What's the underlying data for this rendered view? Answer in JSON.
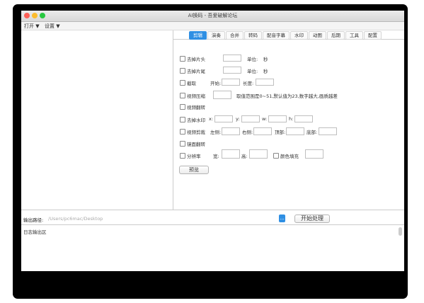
{
  "window": {
    "title": "AI换码 - 吾爱破解论坛",
    "colors": {
      "close": "#fc5f57",
      "minimize": "#fdbc2e",
      "zoom": "#28c840",
      "accent": "#2f8fe3"
    }
  },
  "menubar": {
    "open": "打开 ▼",
    "settings": "设置 ▼"
  },
  "tabs": [
    "剪辑",
    "演奏",
    "合并",
    "转码",
    "配音字幕",
    "水印",
    "动图",
    "后期",
    "工具",
    "配置"
  ],
  "active_tab": "剪辑",
  "form": {
    "trim_head": "去掉片头",
    "trim_tail": "去掉片尾",
    "unit_label": "单位:",
    "unit_value": "秒",
    "cut": "截取",
    "start_label": "开始:",
    "length_label": "长度:",
    "compress": "视频压缩",
    "compress_hint": "取值范围是0~51,默认值为23,数字越大,画质越差",
    "rotate": "视频翻转",
    "remove_watermark": "去掉水印",
    "x": "x:",
    "y": "y:",
    "w": "w:",
    "h": "h:",
    "crop": "视频剪裁",
    "left": "左侧:",
    "right": "右侧:",
    "top": "顶部:",
    "bottom": "底部:",
    "mirror": "镜面翻转",
    "resolution": "分辨率",
    "width": "宽:",
    "height": "高:",
    "fill_color": "颜色填充",
    "preview": "预览"
  },
  "output": {
    "label": "输出路径:",
    "path_placeholder": "/Users/pc6mac/Desktop",
    "browse": "...",
    "start": "开始处理"
  },
  "log": {
    "label": "日志输出区"
  }
}
